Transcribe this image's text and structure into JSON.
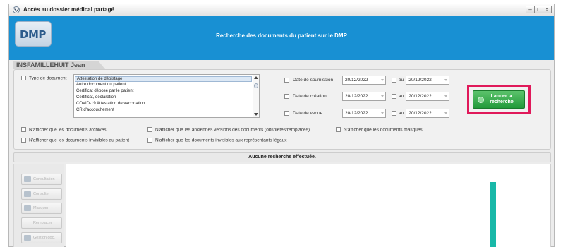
{
  "window": {
    "title": "Accès au dossier médical partagé",
    "controls": [
      "–",
      "□",
      "x"
    ]
  },
  "banner": {
    "logo": "DMP",
    "title": "Recherche des documents du patient sur le DMP"
  },
  "patient": {
    "name": "INSFAMILLEHUIT Jean"
  },
  "search": {
    "doc_type_label": "Type de document",
    "doc_types": [
      "Attestation de dépistage",
      "Autre document du patient",
      "Certificat déposé par le patient",
      "Certificat, déclaration",
      "COVID-19 Attestation de vaccination",
      "CR d'accouchement"
    ],
    "selected_doc_type": "Attestation de dépistage",
    "date_rows": [
      {
        "label": "Date de soumission",
        "from": "20/12/2022",
        "to_label": "au",
        "to": "20/12/2022"
      },
      {
        "label": "Date de création",
        "from": "20/12/2022",
        "to_label": "au",
        "to": "20/12/2022"
      },
      {
        "label": "Date de venue",
        "from": "20/12/2022",
        "to_label": "au",
        "to": "20/12/2022"
      }
    ],
    "launch_button": "Lancer la recherche",
    "options_row1": [
      "N'afficher que les documents archivés",
      "N'afficher que les anciennes versions des documents (obsolètes/remplacés)",
      "N'afficher que les documents masqués"
    ],
    "options_row2": [
      "N'afficher que les documents invisibles au patient",
      "N'afficher que les documents invisibles aux représentants légaux"
    ]
  },
  "results": {
    "status": "Aucune recherche effectuée.",
    "side_buttons": [
      "Consultation",
      "Consulter",
      "Masquer",
      "Remplacer",
      "Gestion doc."
    ]
  },
  "colors": {
    "banner": "#1890d3",
    "launch_button": "#2fa845",
    "highlight_frame": "#e0195a",
    "teal_marker": "#19b8a8"
  }
}
